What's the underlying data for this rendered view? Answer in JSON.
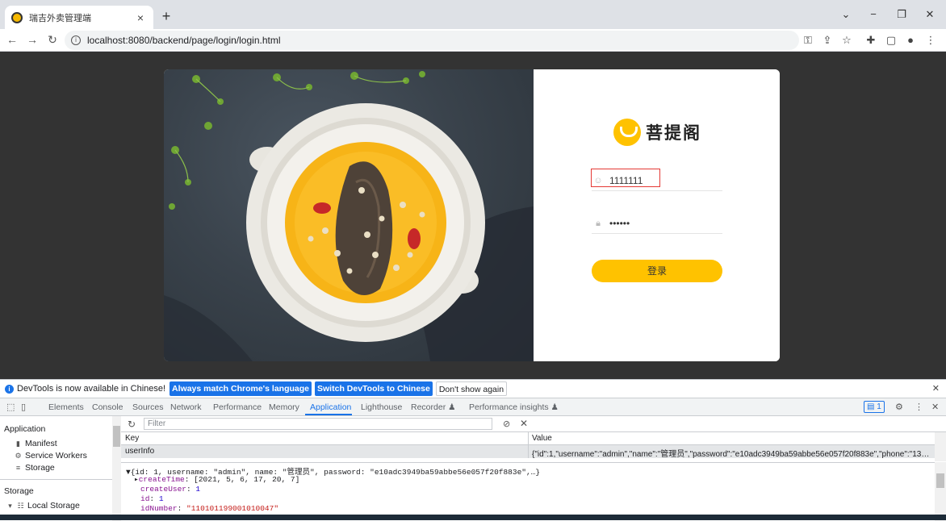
{
  "tab": {
    "title": "瑞吉外卖管理端",
    "close": "×",
    "new_tab": "+"
  },
  "window": {
    "minimize": "−",
    "restore": "❐",
    "close": "✕",
    "tab_search": "⌄"
  },
  "address": {
    "url": "localhost:8080/backend/page/login/login.html",
    "back": "←",
    "forward": "→",
    "reload": "↻"
  },
  "toolbar_icons": [
    "key-icon",
    "share-icon",
    "star-icon",
    "extensions-icon",
    "sidepanel-icon",
    "profile-icon",
    "menu-icon"
  ],
  "login": {
    "brand": "菩提阁",
    "username_value": "1111111",
    "password_value": "••••••",
    "submit_label": "登录",
    "accent_color": "#ffc200"
  },
  "devtools": {
    "notice": {
      "text": "DevTools is now available in Chinese!",
      "btn_match": "Always match Chrome's language",
      "btn_switch": "Switch DevTools to Chinese",
      "btn_dismiss": "Don't show again"
    },
    "tabs": [
      "Elements",
      "Console",
      "Sources",
      "Network",
      "Performance",
      "Memory",
      "Application",
      "Lighthouse",
      "Recorder ♟",
      "Performance insights ♟"
    ],
    "active_tab": "Application",
    "message_count": "1",
    "sidebar": {
      "application_label": "Application",
      "manifest": "Manifest",
      "service_workers": "Service Workers",
      "storage_item": "Storage",
      "storage_label": "Storage",
      "local_storage": "Local Storage"
    },
    "filter_placeholder": "Filter",
    "table": {
      "key_header": "Key",
      "value_header": "Value",
      "row_key": "userInfo",
      "row_value": "{\"id\":1,\"username\":\"admin\",\"name\":\"管理员\",\"password\":\"e10adc3949ba59abbe56e057f20f883e\",\"phone\":\"13812312312\",\"..."
    },
    "preview": {
      "line1": "▼{id: 1, username: \"admin\", name: \"管理员\", password: \"e10adc3949ba59abbe56e057f20f883e\",…}",
      "createTime_key": "createTime",
      "createTime_val": "[2021, 5, 6, 17, 20, 7]",
      "createUser_key": "createUser",
      "createUser_val": "1",
      "id_key": "id",
      "id_val": "1",
      "idNumber_key": "idNumber",
      "idNumber_val": "\"110101199001010047\""
    }
  }
}
